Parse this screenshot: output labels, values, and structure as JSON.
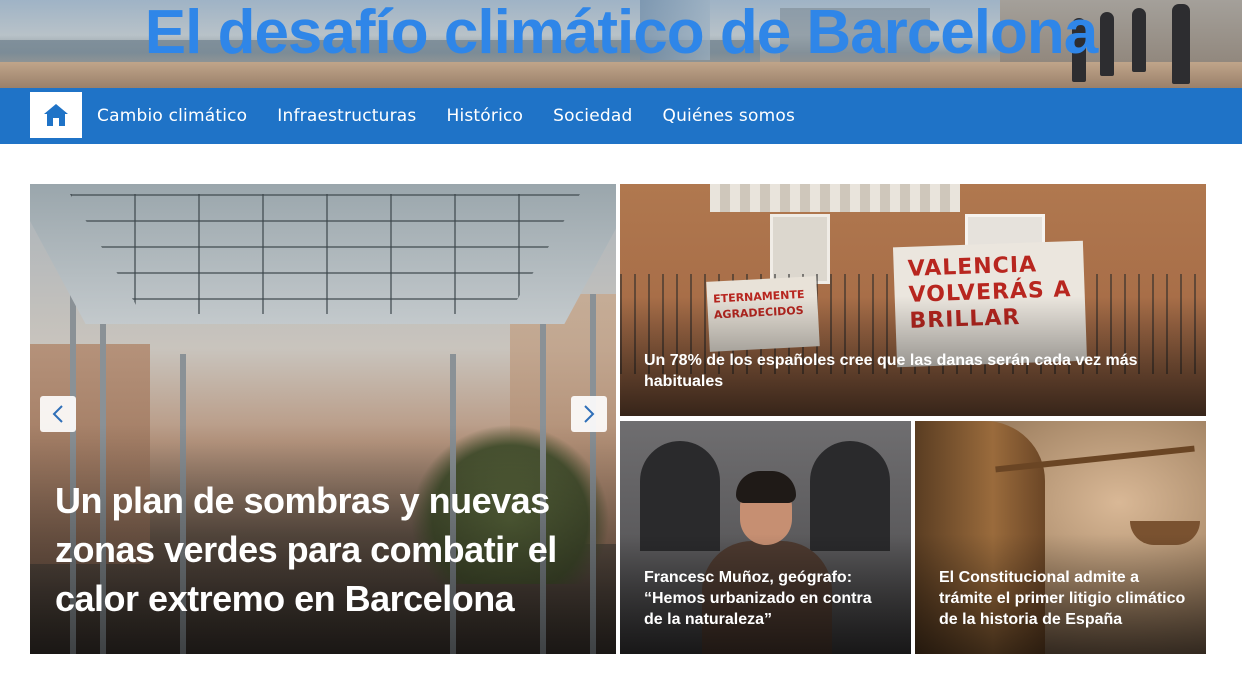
{
  "site": {
    "title": "El desafío climático de Barcelona"
  },
  "nav": {
    "home_icon": "home-icon",
    "items": [
      {
        "label": "Cambio climático"
      },
      {
        "label": "Infraestructuras"
      },
      {
        "label": "Histórico"
      },
      {
        "label": "Sociedad"
      },
      {
        "label": "Quiénes somos"
      }
    ]
  },
  "hero": {
    "title": "Un plan de sombras y nuevas zonas verdes para combatir el calor extremo en Barcelona",
    "prev_icon": "chevron-left-icon",
    "next_icon": "chevron-right-icon"
  },
  "cards": [
    {
      "title": "Un 78% de los españoles cree que las danas serán cada vez más habituales",
      "image_text_left": "ETERNAMENTE AGRADECIDOS",
      "image_text_right": "VALENCIA VOLVERÁS A BRILLAR"
    },
    {
      "title": "Francesc Muñoz, geógrafo: “Hemos urbanizado en contra de la naturaleza”"
    },
    {
      "title": "El Constitucional admite a trámite el primer litigio climático de la historia de España"
    }
  ],
  "colors": {
    "title_blue": "#2f86e8",
    "nav_blue": "#1f73c7",
    "text_white": "#ffffff"
  }
}
